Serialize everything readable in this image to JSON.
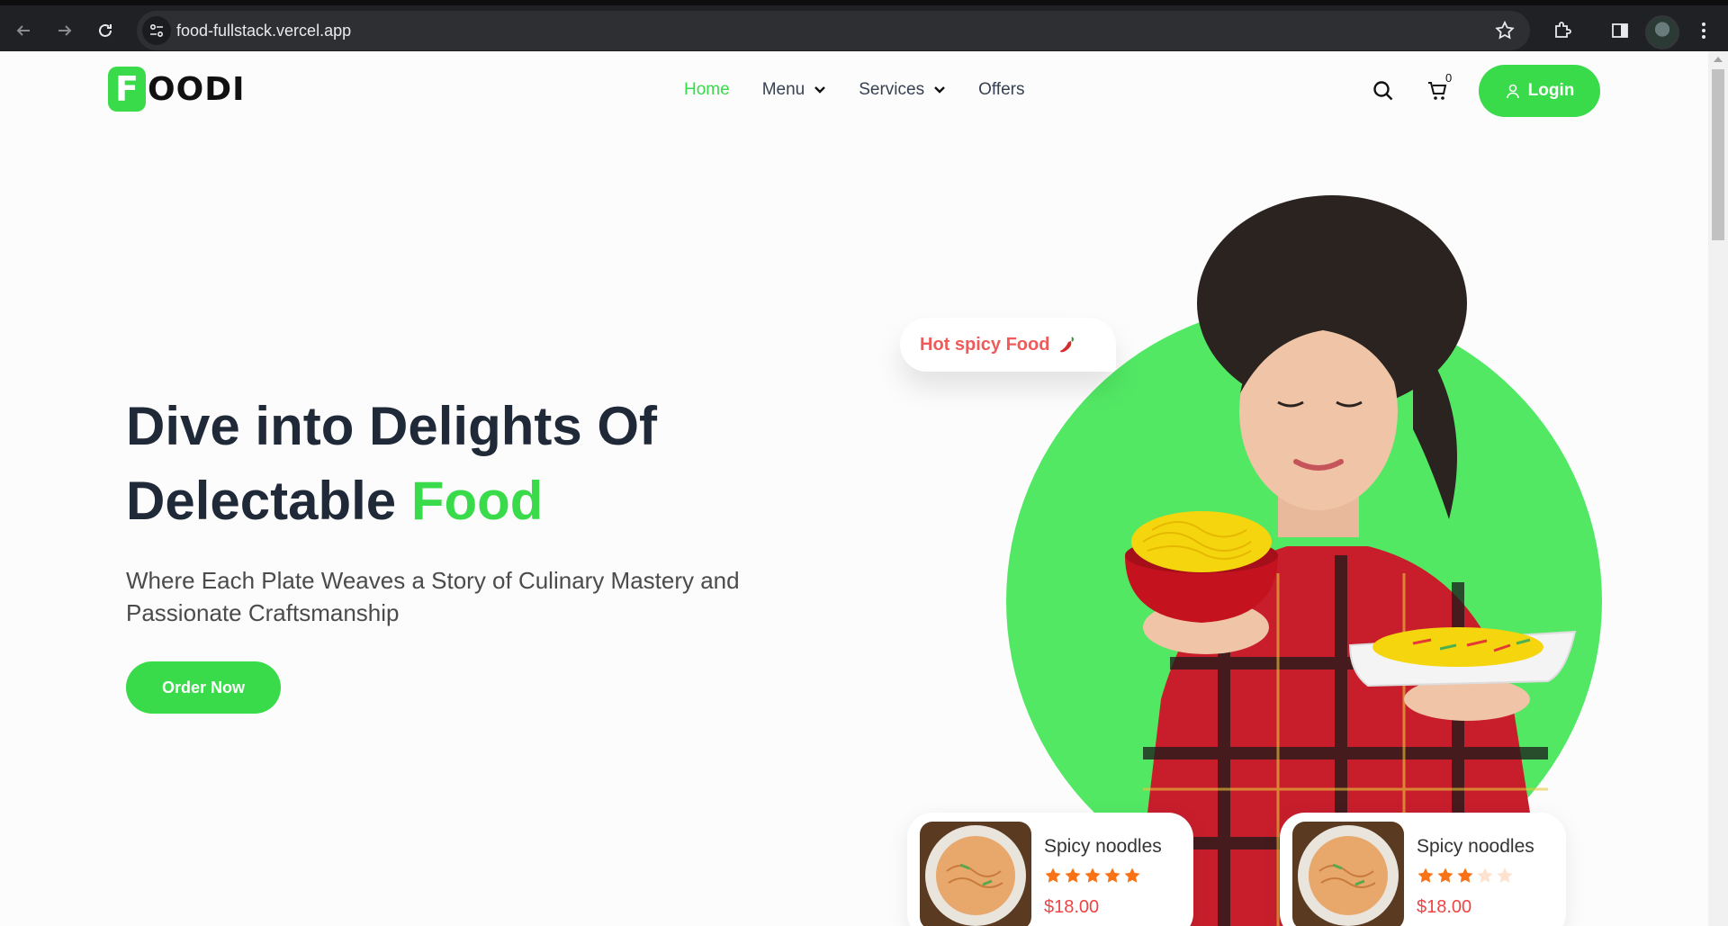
{
  "browser": {
    "url": "food-fullstack.vercel.app"
  },
  "nav": {
    "logo_letter": "F",
    "logo_text": "OODI",
    "items": [
      {
        "label": "Home",
        "active": true,
        "dropdown": false
      },
      {
        "label": "Menu",
        "active": false,
        "dropdown": true
      },
      {
        "label": "Services",
        "active": false,
        "dropdown": true
      },
      {
        "label": "Offers",
        "active": false,
        "dropdown": false
      }
    ],
    "cart_count": "0",
    "login_label": "Login"
  },
  "hero": {
    "title_line1": "Dive into Delights Of",
    "title_line2_prefix": "Delectable ",
    "title_line2_highlight": "Food",
    "subtitle": "Where Each Plate Weaves a Story of Culinary Mastery and Passionate Craftsmanship",
    "cta_label": "Order Now",
    "bubble_text": "Hot spicy Food"
  },
  "cards": [
    {
      "name": "Spicy noodles",
      "rating": 5,
      "max_rating": 5,
      "price": "$18.00"
    },
    {
      "name": "Spicy noodles",
      "rating": 3,
      "max_rating": 5,
      "price": "$18.00"
    }
  ],
  "colors": {
    "brand": "#39db4a",
    "circle": "#52e864",
    "price": "#ef4444",
    "star": "#f97316",
    "star_empty": "#fde3cf",
    "bubble_text": "#ef5a5a"
  }
}
